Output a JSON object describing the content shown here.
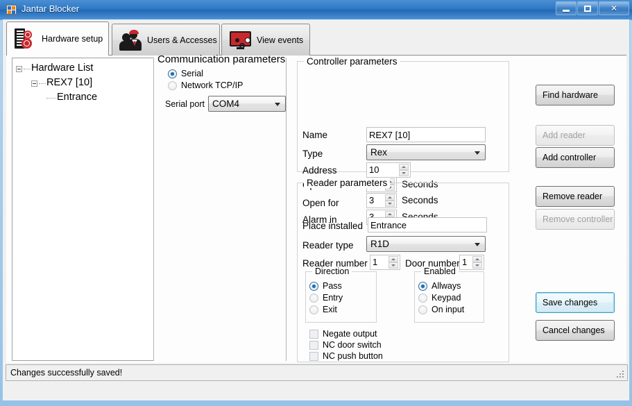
{
  "window": {
    "title": "Jantar Blocker",
    "app_icon": "app-window-icon",
    "minimize_label": "Minimize",
    "maximize_label": "Maximize",
    "close_label": "Close"
  },
  "tabs": [
    {
      "label": "Hardware setup",
      "icon": "hardware-rack-gears-icon",
      "active": true
    },
    {
      "label": "Users & Accesses",
      "icon": "users-people-icon",
      "active": false
    },
    {
      "label": "View events",
      "icon": "monitor-events-icon",
      "active": false
    }
  ],
  "tree": {
    "root": "Hardware List",
    "child": "REX7 [10]",
    "leaf": "Entrance"
  },
  "communication": {
    "title": "Communication parameters",
    "radio_serial": "Serial",
    "radio_network": "Network TCP/IP",
    "selected": "Serial",
    "serial_port_label": "Serial port",
    "serial_port_value": "COM4"
  },
  "controller": {
    "title": "Controller parameters",
    "name_label": "Name",
    "name_value": "REX7 [10]",
    "type_label": "Type",
    "type_value": "Rex",
    "address_label": "Address",
    "address_value": "10",
    "open_in_label": "Open in",
    "open_in_value": "3",
    "open_in_unit": "Seconds",
    "open_for_label": "Open for",
    "open_for_value": "3",
    "open_for_unit": "Seconds",
    "alarm_in_label": "Alarm in",
    "alarm_in_value": "3",
    "alarm_in_unit": "Seconds"
  },
  "reader": {
    "title": "Reader parameters",
    "place_label": "Place installed",
    "place_value": "Entrance",
    "type_label": "Reader type",
    "type_value": "R1D",
    "number_label": "Reader number",
    "number_value": "1",
    "door_label": "Door number",
    "door_value": "1",
    "direction": {
      "title": "Direction",
      "options": [
        "Pass",
        "Entry",
        "Exit"
      ],
      "selected": "Pass"
    },
    "enabled": {
      "title": "Enabled",
      "options": [
        "Allways",
        "Keypad",
        "On input"
      ],
      "selected": "Allways"
    },
    "checkboxes": [
      {
        "label": "Negate output",
        "checked": false
      },
      {
        "label": "NC door switch",
        "checked": false
      },
      {
        "label": "NC push button",
        "checked": false
      }
    ]
  },
  "actions": {
    "find_hardware": "Find hardware",
    "add_reader": "Add reader",
    "add_controller": "Add controller",
    "remove_reader": "Remove reader",
    "remove_controller": "Remove controller",
    "save_changes": "Save changes",
    "cancel_changes": "Cancel changes"
  },
  "status": {
    "message": "Changes successfully saved!"
  },
  "colors": {
    "accent_red": "#c8282d",
    "title_blue": "#2e78c4",
    "focus_cyan": "#3c9cc0"
  }
}
